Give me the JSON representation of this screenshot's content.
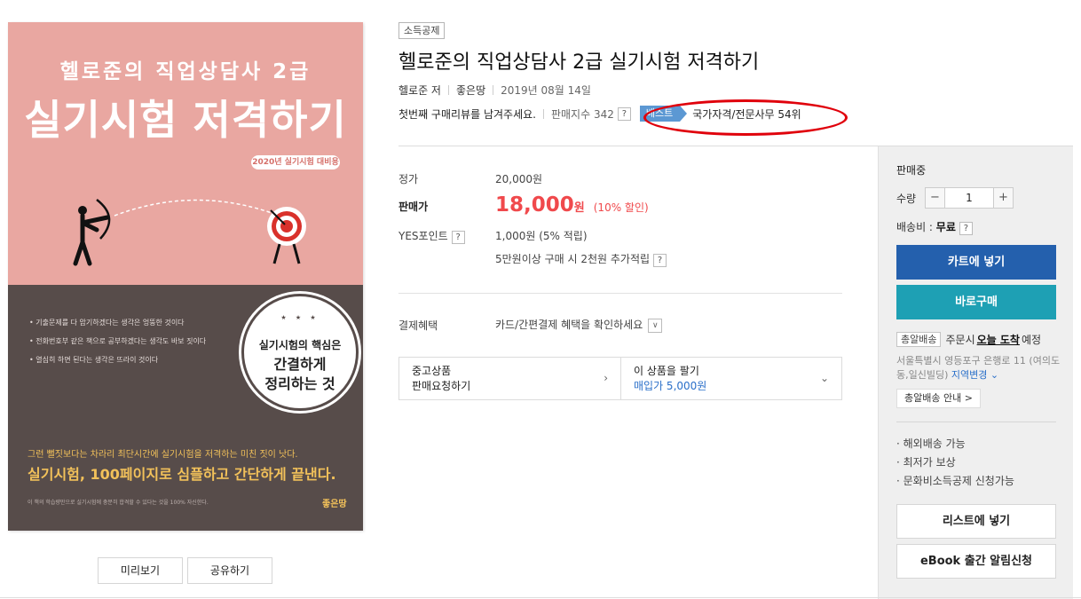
{
  "cover": {
    "line1": "헬로준의 직업상담사 2급",
    "line2": "실기시험 저격하기",
    "badge": "2020년 실기시험 대비용",
    "bullets": [
      "• 기출문제를 다 암기하겠다는 생각은 엉뚱한 것이다",
      "• 전화번호부 같은 책으로 공부하겠다는 생각도 바보 짓이다",
      "• 열심히 하면 된다는 생각은 뜨라이 것이다"
    ],
    "circle_stars": "★ ★ ★",
    "circle_line1": "실기시험의 핵심은",
    "circle_line2": "간결하게",
    "circle_line3": "정리하는 것",
    "tagline": "그런 뻘짓보다는 차라리 최단시간에 실기시험을 저격하는 미친 짓이 낫다.",
    "main_copy": "실기시험, 100페이지로 심플하고 간단하게 끝낸다.",
    "fine_print": "이 책의 학습량만으로 실기시험에 충분히 합격할 수 있다는 것을 100% 자신한다.",
    "publisher_logo": "좋은땅"
  },
  "cover_buttons": {
    "preview": "미리보기",
    "share": "공유하기"
  },
  "product": {
    "tax_badge": "소득공제",
    "title": "헬로준의 직업상담사 2급 실기시험 저격하기",
    "author": "헬로준 저",
    "publisher": "좋은땅",
    "date": "2019년 08월 14일",
    "review_prompt": "첫번째 구매리뷰를 남겨주세요.",
    "sales_index": "판매지수 342",
    "help_mark": "?",
    "best_label": "베스트",
    "rank_text": "국가자격/전문사무 54위"
  },
  "price": {
    "list_label": "정가",
    "list_value": "20,000원",
    "sale_label": "판매가",
    "sale_value": "18,000",
    "sale_unit": "원",
    "discount": "(10% 할인)",
    "points_label": "YES포인트",
    "points_value": "1,000원 (5% 적립)",
    "extra_points": "5만원이상 구매 시 2천원 추가적립",
    "benefit_label": "결제혜택",
    "benefit_value": "카드/간편결제 혜택을 확인하세요"
  },
  "used": {
    "left_line1": "중고상품",
    "left_line2": "판매요청하기",
    "right_line1": "이 상품을 팔기",
    "right_line2": "매입가 5,000원"
  },
  "panel": {
    "status": "판매중",
    "qty_label": "수량",
    "qty_value": "1",
    "minus": "−",
    "plus": "+",
    "ship_label": "배송비 : ",
    "ship_value": "무료",
    "cart_button": "카트에 넣기",
    "buy_button": "바로구매",
    "delivery_tag": "총알배송",
    "delivery_pre": "주문시",
    "delivery_when": "오늘 도착",
    "delivery_post": "예정",
    "address": "서울특별시 영등포구 은행로 11 (여의도동,일신빌딩)",
    "region_change": "지역변경",
    "guide_button": "총알배송 안내 >",
    "features": [
      "해외배송 가능",
      "최저가 보상",
      "문화비소득공제 신청가능"
    ],
    "wishlist_button": "리스트에 넣기",
    "ebook_button": "eBook 출간 알림신청"
  },
  "colors": {
    "cart": "#2460ad",
    "buy": "#1ea0b4",
    "price": "#f0494c",
    "best": "#5c98d3",
    "annotation": "#e0000b"
  }
}
